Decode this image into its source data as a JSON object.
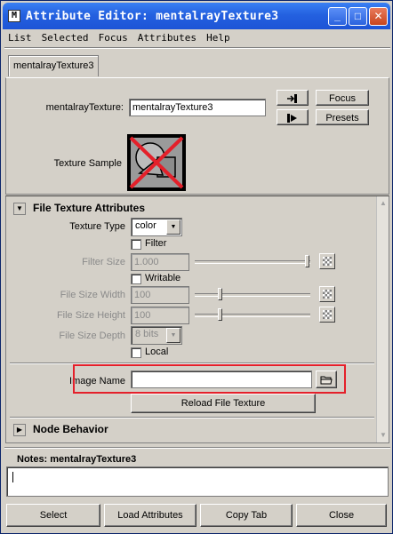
{
  "window": {
    "title": "Attribute Editor: mentalrayTexture3",
    "app_icon_glyph": "M",
    "controls": {
      "minimize": "_",
      "maximize": "□",
      "close": "✕"
    }
  },
  "menubar": [
    "List",
    "Selected",
    "Focus",
    "Attributes",
    "Help"
  ],
  "tab": {
    "label": "mentalrayTexture3"
  },
  "node": {
    "type_label": "mentalrayTexture:",
    "name_value": "mentalrayTexture3",
    "focus_label": "Focus",
    "presets_label": "Presets",
    "sample_label": "Texture Sample"
  },
  "file_texture": {
    "title": "File Texture Attributes",
    "texture_type_label": "Texture Type",
    "texture_type_value": "color",
    "filter_label": "Filter",
    "filter_size_label": "Filter Size",
    "filter_size_value": "1.000",
    "writable_label": "Writable",
    "file_size_width_label": "File Size Width",
    "file_size_width_value": "100",
    "file_size_height_label": "File Size Height",
    "file_size_height_value": "100",
    "file_size_depth_label": "File Size Depth",
    "file_size_depth_value": "8 bits",
    "local_label": "Local",
    "image_name_label": "Image Name",
    "image_name_value": "",
    "reload_label": "Reload File Texture"
  },
  "node_behavior": {
    "title": "Node Behavior"
  },
  "notes": {
    "label": "Notes:  mentalrayTexture3",
    "value": ""
  },
  "bottom_buttons": {
    "select": "Select",
    "load_attributes": "Load Attributes",
    "copy_tab": "Copy Tab",
    "close": "Close"
  },
  "colors": {
    "highlight_box": "#e4202a",
    "titlebar": "#2461e0"
  }
}
